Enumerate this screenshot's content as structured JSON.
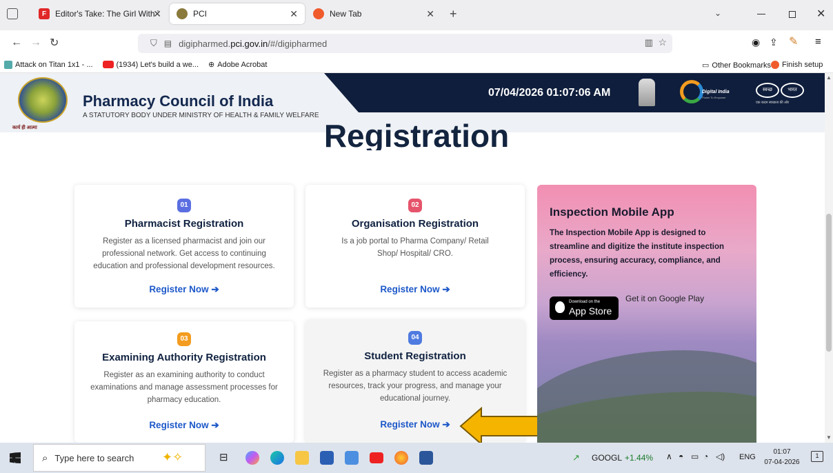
{
  "browser": {
    "tabs": [
      {
        "label": "Editor's Take: The Girl With The",
        "favicon": "F",
        "active": false
      },
      {
        "label": "PCI",
        "active": true
      },
      {
        "label": "New Tab",
        "active": false
      }
    ],
    "url_plain": "digipharmed.",
    "url_domain": "pci.gov.in",
    "url_path": "/#/digipharmed",
    "bookmarks": [
      {
        "label": "Attack on Titan 1x1 - ..."
      },
      {
        "label": "(1934) Let's build a we..."
      },
      {
        "label": "Adobe Acrobat"
      }
    ],
    "bookmarks_right": [
      "Other Bookmarks",
      "Finish setup"
    ]
  },
  "site": {
    "org_name": "Pharmacy Council of India",
    "org_tagline": "A STATUTORY BODY UNDER MINISTRY OF HEALTH & FAMILY WELFARE",
    "logo_caption": "कार्य ही आत्मा",
    "datetime": "07/04/2026 01:07:06 AM",
    "digital_india": "Digital India",
    "digital_india_sub": "Power To Empower",
    "swachh_left": "स्वच्छ",
    "swachh_right": "भारत",
    "swachh_caption": "एक कदम स्वच्छता की ओर",
    "heading": "Registration",
    "register_label": "Register Now",
    "cards": [
      {
        "num": "01",
        "color": "#5b6ee1",
        "title": "Pharmacist Registration",
        "desc": "Register as a licensed pharmacist and join our professional network. Get access to continuing education and professional development resources."
      },
      {
        "num": "02",
        "color": "#e5546b",
        "title": "Organisation Registration",
        "desc": "Is a job portal to Pharma Company/ Retail Shop/ Hospital/ CRO."
      },
      {
        "num": "03",
        "color": "#f39c1f",
        "title": "Examining Authority Registration",
        "desc": "Register as an examining authority to conduct examinations and manage assessment processes for pharmacy education."
      },
      {
        "num": "04",
        "color": "#4f7be0",
        "title": "Student Registration",
        "desc": "Register as a pharmacy student to access academic resources, track your progress, and manage your educational journey."
      }
    ],
    "app": {
      "title": "Inspection Mobile App",
      "desc": "The Inspection Mobile App is designed to streamline and digitize the institute inspection process, ensuring accuracy, compliance, and efficiency.",
      "appstore_small": "Download on the",
      "appstore_big": "App Store",
      "google_play": "Get it on Google Play"
    }
  },
  "taskbar": {
    "search_placeholder": "Type here to search",
    "ticker": "GOOGL",
    "ticker_change": "+1.44%",
    "lang": "ENG",
    "time": "01:07",
    "date": "07-04-2026",
    "notif_count": "1"
  }
}
